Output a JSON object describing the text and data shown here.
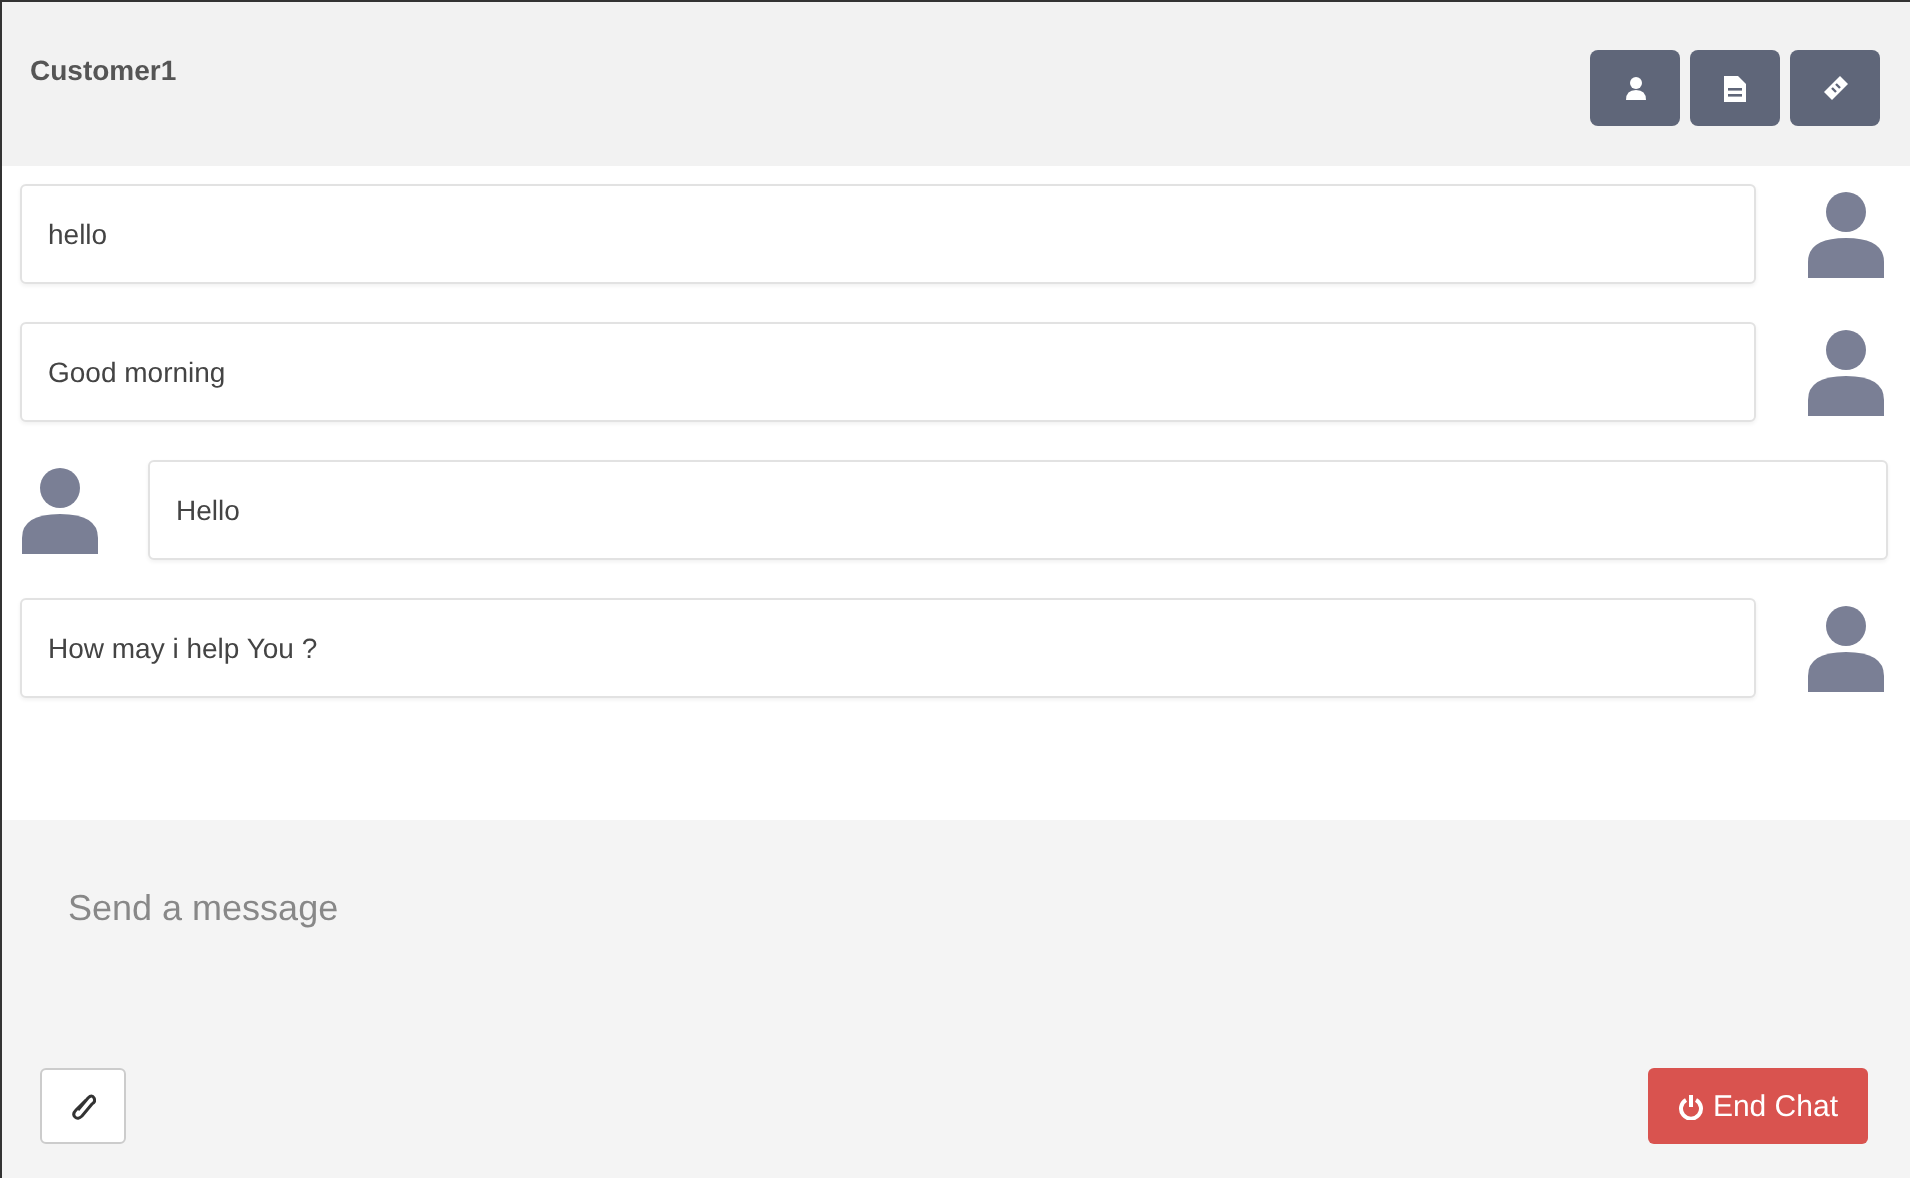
{
  "header": {
    "title": "Customer1",
    "actions": [
      {
        "kind": "user"
      },
      {
        "kind": "file"
      },
      {
        "kind": "tag"
      }
    ]
  },
  "messages": [
    {
      "text": "hello",
      "kind": "sent"
    },
    {
      "text": "Good morning",
      "kind": "sent"
    },
    {
      "text": "Hello",
      "kind": "received"
    },
    {
      "text": "How may i help You ?",
      "kind": "sent"
    }
  ],
  "composer": {
    "placeholder": "Send a message"
  },
  "footer": {
    "end_button": "End Chat"
  }
}
